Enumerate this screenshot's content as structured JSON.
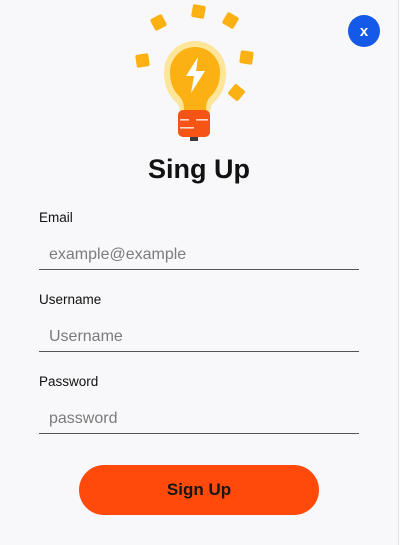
{
  "dialog": {
    "title": "Sing Up",
    "close_label": "x"
  },
  "illustration": {
    "icon": "lightbulb-bolt-icon",
    "colors": {
      "bulb": "#fbb013",
      "glow": "#fde59a",
      "base": "#f65414",
      "bolt": "#ffffff"
    }
  },
  "form": {
    "email": {
      "label": "Email",
      "placeholder": "example@example",
      "value": ""
    },
    "username": {
      "label": "Username",
      "placeholder": "Username",
      "value": ""
    },
    "password": {
      "label": "Password",
      "placeholder": "password",
      "value": ""
    }
  },
  "submit_label": "Sign Up",
  "colors": {
    "accent": "#ff4a0c",
    "close_button": "#1459e8",
    "background": "#f8f8fa"
  }
}
